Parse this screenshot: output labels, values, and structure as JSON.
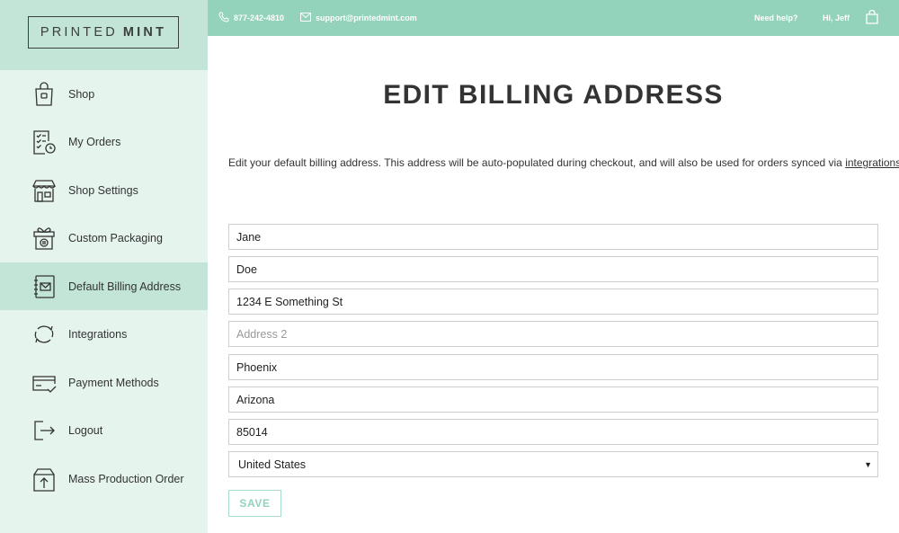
{
  "brand": {
    "logo_part1": "PRINTED",
    "logo_part2": "MINT"
  },
  "topbar": {
    "phone": "877-242-4810",
    "email": "support@printedmint.com",
    "help": "Need help?",
    "greeting": "Hi, Jeff"
  },
  "sidebar": {
    "items": [
      {
        "label": "Shop",
        "icon": "shopping-bag-icon"
      },
      {
        "label": "My Orders",
        "icon": "checklist-clock-icon"
      },
      {
        "label": "Shop Settings",
        "icon": "storefront-icon"
      },
      {
        "label": "Custom Packaging",
        "icon": "gift-box-icon"
      },
      {
        "label": "Default Billing Address",
        "icon": "address-book-icon",
        "active": true
      },
      {
        "label": "Integrations",
        "icon": "sync-arrows-icon"
      },
      {
        "label": "Payment Methods",
        "icon": "credit-card-check-icon"
      },
      {
        "label": "Logout",
        "icon": "logout-arrow-icon"
      },
      {
        "label": "Mass Production Order",
        "icon": "box-upload-icon"
      }
    ]
  },
  "main": {
    "title": "EDIT BILLING ADDRESS",
    "description": "Edit your default billing address. This address will be auto-populated during checkout, and will also be used for orders synced via",
    "description_link": "integrations",
    "description_end": ".",
    "form": {
      "first_name": "Jane",
      "last_name": "Doe",
      "address1": "1234 E Something St",
      "address2_placeholder": "Address 2",
      "city": "Phoenix",
      "state": "Arizona",
      "zip": "85014",
      "country": "United States"
    },
    "save_label": "SAVE"
  },
  "colors": {
    "accent": "#93d2bb",
    "sidebar_bg": "#e6f4ee",
    "sidebar_active": "#c2e5d7",
    "text": "#333333"
  }
}
